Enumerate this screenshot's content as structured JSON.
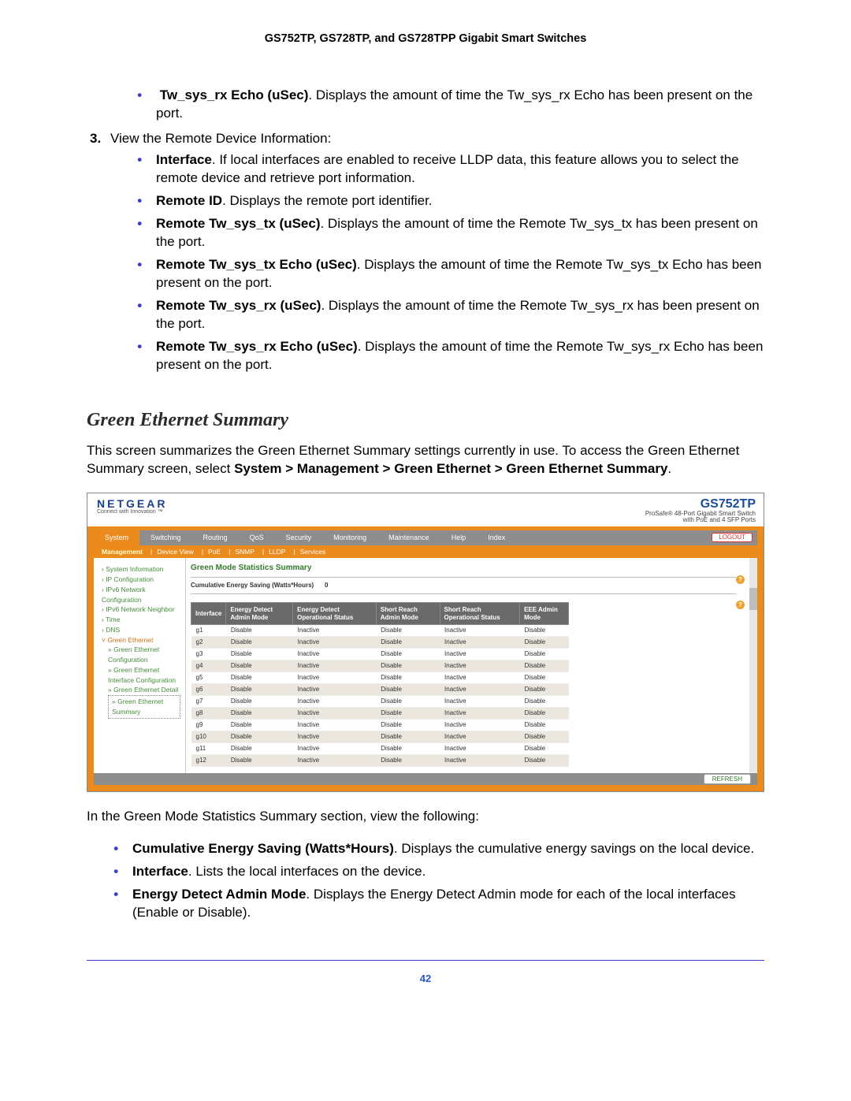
{
  "doc_title": "GS752TP, GS728TP, and GS728TPP Gigabit Smart Switches",
  "bullet_top": {
    "label": "Tw_sys_rx Echo (uSec)",
    "text": ". Displays the amount of time the Tw_sys_rx Echo has been present on the port."
  },
  "step3": {
    "num": "3.",
    "text": "View the Remote Device Information:",
    "items": [
      {
        "label": "Interface",
        "text": ". If local interfaces are enabled to receive LLDP data, this feature allows you to select the remote device and retrieve port information."
      },
      {
        "label": "Remote ID",
        "text": ". Displays the remote port identifier."
      },
      {
        "label": "Remote Tw_sys_tx (uSec)",
        "text": ". Displays the amount of time the Remote Tw_sys_tx has been present on the port."
      },
      {
        "label": "Remote Tw_sys_tx Echo (uSec)",
        "text": ". Displays the amount of time the Remote Tw_sys_tx Echo has been present on the port."
      },
      {
        "label": "Remote Tw_sys_rx (uSec)",
        "text": ". Displays the amount of time the Remote Tw_sys_rx has been present on the port."
      },
      {
        "label": "Remote Tw_sys_rx Echo (uSec)",
        "text": ". Displays the amount of time the Remote Tw_sys_rx Echo has been present on the port."
      }
    ]
  },
  "section_heading": "Green Ethernet Summary",
  "intro": {
    "p1": "This screen summarizes the Green Ethernet Summary settings currently in use. To access the Green Ethernet Summary screen, select ",
    "path": "System > Management > Green Ethernet > Green Ethernet Summary",
    "p2": "."
  },
  "screenshot": {
    "logo": "NETGEAR",
    "tagline": "Connect with Innovation ™",
    "model": "GS752TP",
    "model_sub1": "ProSafe® 48-Port Gigabit Smart Switch",
    "model_sub2": "with PoE and 4 SFP Ports",
    "logout": "LOGOUT",
    "tabs1": [
      "System",
      "Switching",
      "Routing",
      "QoS",
      "Security",
      "Monitoring",
      "Maintenance",
      "Help",
      "Index"
    ],
    "tabs2": [
      "Management",
      "Device View",
      "PoE",
      "SNMP",
      "LLDP",
      "Services"
    ],
    "sidebar": {
      "items": [
        "System Information",
        "IP Configuration",
        "IPv6 Network Configuration",
        "IPv6 Network Neighbor",
        "Time",
        "DNS"
      ],
      "cat": "Green Ethernet",
      "subs": [
        "Green Ethernet Configuration",
        "Green Ethernet Interface Configuration",
        "Green Ethernet Detail"
      ],
      "selected": "Green Ethernet Summary"
    },
    "panel_title": "Green Mode Statistics Summary",
    "cum_label": "Cumulative Energy Saving (Watts*Hours)",
    "cum_value": "0",
    "help": "?",
    "columns": [
      "Interface",
      "Energy Detect Admin Mode",
      "Energy Detect Operational Status",
      "Short Reach Admin Mode",
      "Short Reach Operational Status",
      "EEE Admin Mode"
    ],
    "rows": [
      [
        "g1",
        "Disable",
        "Inactive",
        "Disable",
        "Inactive",
        "Disable"
      ],
      [
        "g2",
        "Disable",
        "Inactive",
        "Disable",
        "Inactive",
        "Disable"
      ],
      [
        "g3",
        "Disable",
        "Inactive",
        "Disable",
        "Inactive",
        "Disable"
      ],
      [
        "g4",
        "Disable",
        "Inactive",
        "Disable",
        "Inactive",
        "Disable"
      ],
      [
        "g5",
        "Disable",
        "Inactive",
        "Disable",
        "Inactive",
        "Disable"
      ],
      [
        "g6",
        "Disable",
        "Inactive",
        "Disable",
        "Inactive",
        "Disable"
      ],
      [
        "g7",
        "Disable",
        "Inactive",
        "Disable",
        "Inactive",
        "Disable"
      ],
      [
        "g8",
        "Disable",
        "Inactive",
        "Disable",
        "Inactive",
        "Disable"
      ],
      [
        "g9",
        "Disable",
        "Inactive",
        "Disable",
        "Inactive",
        "Disable"
      ],
      [
        "g10",
        "Disable",
        "Inactive",
        "Disable",
        "Inactive",
        "Disable"
      ],
      [
        "g11",
        "Disable",
        "Inactive",
        "Disable",
        "Inactive",
        "Disable"
      ],
      [
        "g12",
        "Disable",
        "Inactive",
        "Disable",
        "Inactive",
        "Disable"
      ]
    ],
    "refresh": "REFRESH"
  },
  "after_shot": {
    "lead": "In the Green Mode Statistics Summary section, view the following:",
    "items": [
      {
        "label": "Cumulative Energy Saving (Watts*Hours)",
        "text": ". Displays the cumulative energy savings on the local device."
      },
      {
        "label": "Interface",
        "text": ". Lists the local interfaces on the device."
      },
      {
        "label": "Energy Detect Admin Mode",
        "text": ". Displays the Energy Detect Admin mode for each of the local interfaces (Enable or Disable)."
      }
    ]
  },
  "page_num": "42"
}
